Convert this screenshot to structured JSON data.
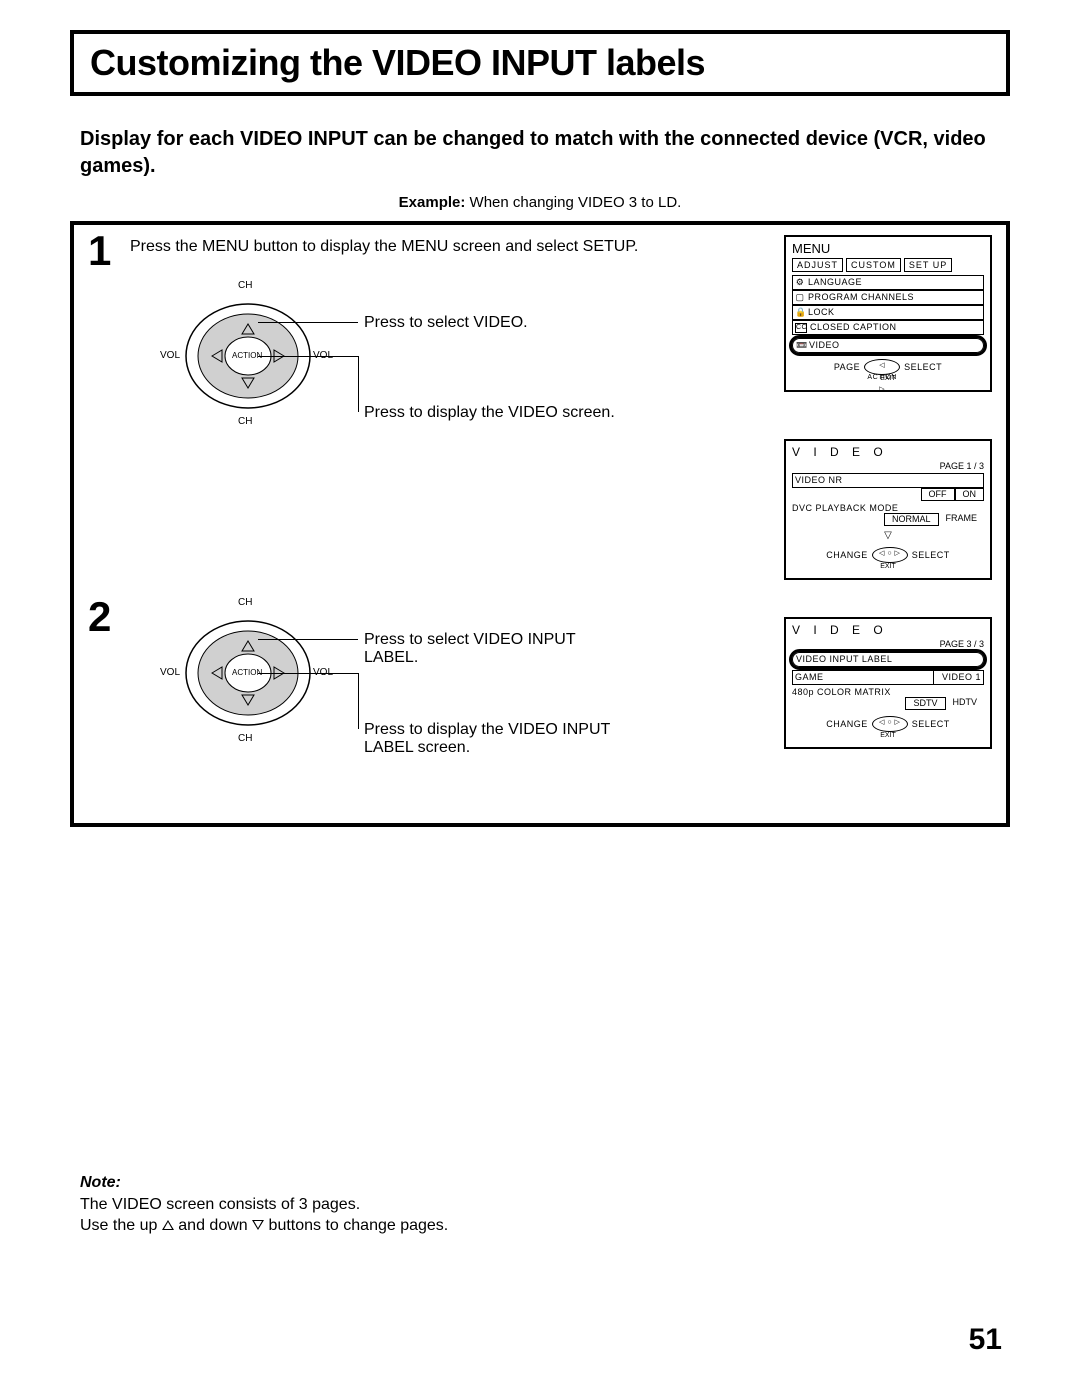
{
  "title": "Customizing the VIDEO INPUT labels",
  "intro": "Display for each VIDEO INPUT can be changed to match with the connected device (VCR, video games).",
  "example_label": "Example:",
  "example_text": " When changing VIDEO 3 to LD.",
  "step1": {
    "num": "1",
    "text": "Press the MENU button to display the MENU screen and select SETUP.",
    "arrow1": "Press to select VIDEO.",
    "arrow2": "Press to display the VIDEO screen."
  },
  "step2": {
    "num": "2",
    "arrow1": "Press to select VIDEO INPUT LABEL.",
    "arrow2": "Press to display the VIDEO INPUT LABEL screen."
  },
  "dpad": {
    "ch": "CH",
    "vol": "VOL",
    "action": "ACTION"
  },
  "osd1": {
    "title": "MENU",
    "tabs": [
      "ADJUST",
      "CUSTOM",
      "SET  UP"
    ],
    "items": [
      {
        "icon": "⚙",
        "label": "LANGUAGE"
      },
      {
        "icon": "▢",
        "label": "PROGRAM  CHANNELS"
      },
      {
        "icon": "🔒",
        "label": "LOCK"
      },
      {
        "icon": "CC",
        "label": "CLOSED  CAPTION"
      },
      {
        "icon": "📼",
        "label": "VIDEO",
        "highlight": true
      }
    ],
    "nav_left": "PAGE",
    "nav_center": "◁ ACTION ▷",
    "nav_right": "SELECT",
    "nav_exit": "EXIT"
  },
  "osd2": {
    "title": "V I D E O",
    "page": "PAGE 1 / 3",
    "row1_label": "VIDEO  NR",
    "row1_opts": [
      "OFF",
      "ON"
    ],
    "row2_label": "DVC  PLAYBACK  MODE",
    "row2_opts": [
      "NORMAL",
      "FRAME"
    ],
    "down": "▽",
    "nav_left": "CHANGE",
    "nav_center": "◁ ○ ▷",
    "nav_right": "SELECT",
    "nav_exit": "EXIT"
  },
  "osd3": {
    "title": "V I D E O",
    "page": "PAGE 3 / 3",
    "row1_label": "VIDEO  INPUT  LABEL",
    "row2_label": "GAME",
    "row2_val": "VIDEO 1",
    "row3_label": "480p  COLOR  MATRIX",
    "row3_opts": [
      "SDTV",
      "HDTV"
    ],
    "nav_left": "CHANGE",
    "nav_center": "◁ ○ ▷",
    "nav_right": "SELECT",
    "nav_exit": "EXIT"
  },
  "note": {
    "label": "Note:",
    "line1": "The VIDEO screen consists of 3 pages.",
    "line2a": "Use the up ",
    "line2b": " and down ",
    "line2c": " buttons to change pages."
  },
  "page_number": "51"
}
